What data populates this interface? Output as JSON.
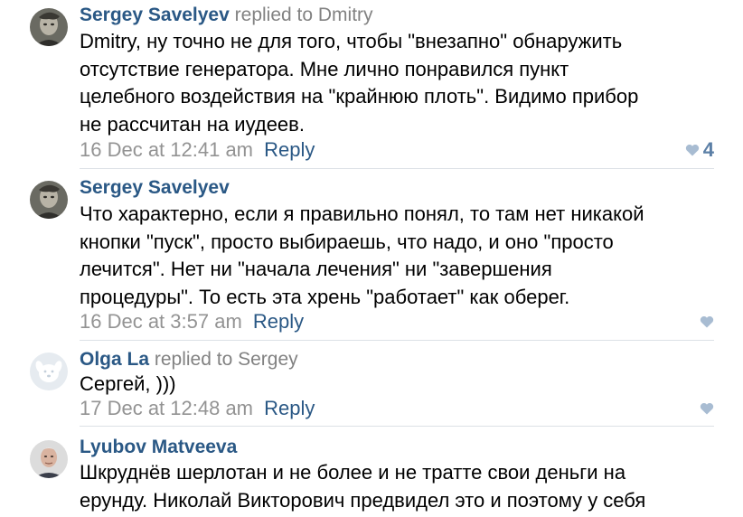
{
  "comments": [
    {
      "author": "Sergey Savelyev",
      "replied_to": "replied to Dmitry",
      "lines": [
        "Dmitry, ну точно не для того, чтобы \"внезапно\" обнаружить",
        "отсутствие генератора. Мне лично понравился пункт",
        "целебного воздействия на \"крайнюю плоть\". Видимо прибор",
        "не рассчитан на иудеев."
      ],
      "date": "16 Dec at 12:41 am",
      "reply_label": "Reply",
      "likes": "4"
    },
    {
      "author": "Sergey Savelyev",
      "replied_to": "",
      "lines": [
        "Что характерно, если я правильно понял, то там нет никакой",
        "кнопки \"пуск\", просто выбираешь, что надо, и оно \"просто",
        "лечится\". Нет ни \"начала лечения\" ни \"завершения",
        "процедуры\". То есть эта хрень \"работает\" как оберег."
      ],
      "date": "16 Dec at 3:57 am",
      "reply_label": "Reply",
      "likes": ""
    },
    {
      "author": "Olga La",
      "replied_to": "replied to Sergey",
      "lines": [
        "Сергей, )))"
      ],
      "date": "17 Dec at 12:48 am",
      "reply_label": "Reply",
      "likes": ""
    },
    {
      "author": "Lyubov Matveeva",
      "replied_to": "",
      "lines": [
        "Шкруднёв шерлотан и не более и не тратте свои деньги на",
        "ерунду. Николай Викторович предвидел это и поэтому у себя"
      ],
      "date": "",
      "reply_label": "",
      "likes": ""
    }
  ],
  "colors": {
    "author": "#2a5885",
    "replied": "#828282",
    "date": "#939393",
    "link": "#2a5885",
    "like_icon": "#a8bcd2",
    "like_count": "#5b7fa6",
    "divider": "#dce1e6"
  },
  "icons": {
    "like": "heart-icon",
    "default_avatar": "dog-avatar-icon"
  }
}
